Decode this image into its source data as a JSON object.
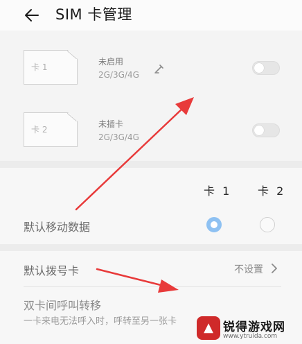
{
  "header": {
    "title": "SIM 卡管理"
  },
  "sims": [
    {
      "card_label": "卡 1",
      "status": "未启用",
      "network": "2G/3G/4G",
      "enabled": false,
      "editable": true
    },
    {
      "card_label": "卡 2",
      "status": "未插卡",
      "network": "2G/3G/4G",
      "enabled": false,
      "editable": false
    }
  ],
  "default_data": {
    "columns": [
      "卡 1",
      "卡 2"
    ],
    "label": "默认移动数据",
    "selected": "卡 1"
  },
  "default_dial": {
    "label": "默认拨号卡",
    "value": "不设置"
  },
  "call_forward": {
    "title": "双卡间呼叫转移",
    "description": "一卡来电无法呼入时，呼转至另一张卡"
  },
  "watermark": {
    "text": "锐得游戏网",
    "url": "www.ytruida.com"
  },
  "colors": {
    "accent": "#8ec1f2",
    "arrow": "#e83a3a"
  }
}
